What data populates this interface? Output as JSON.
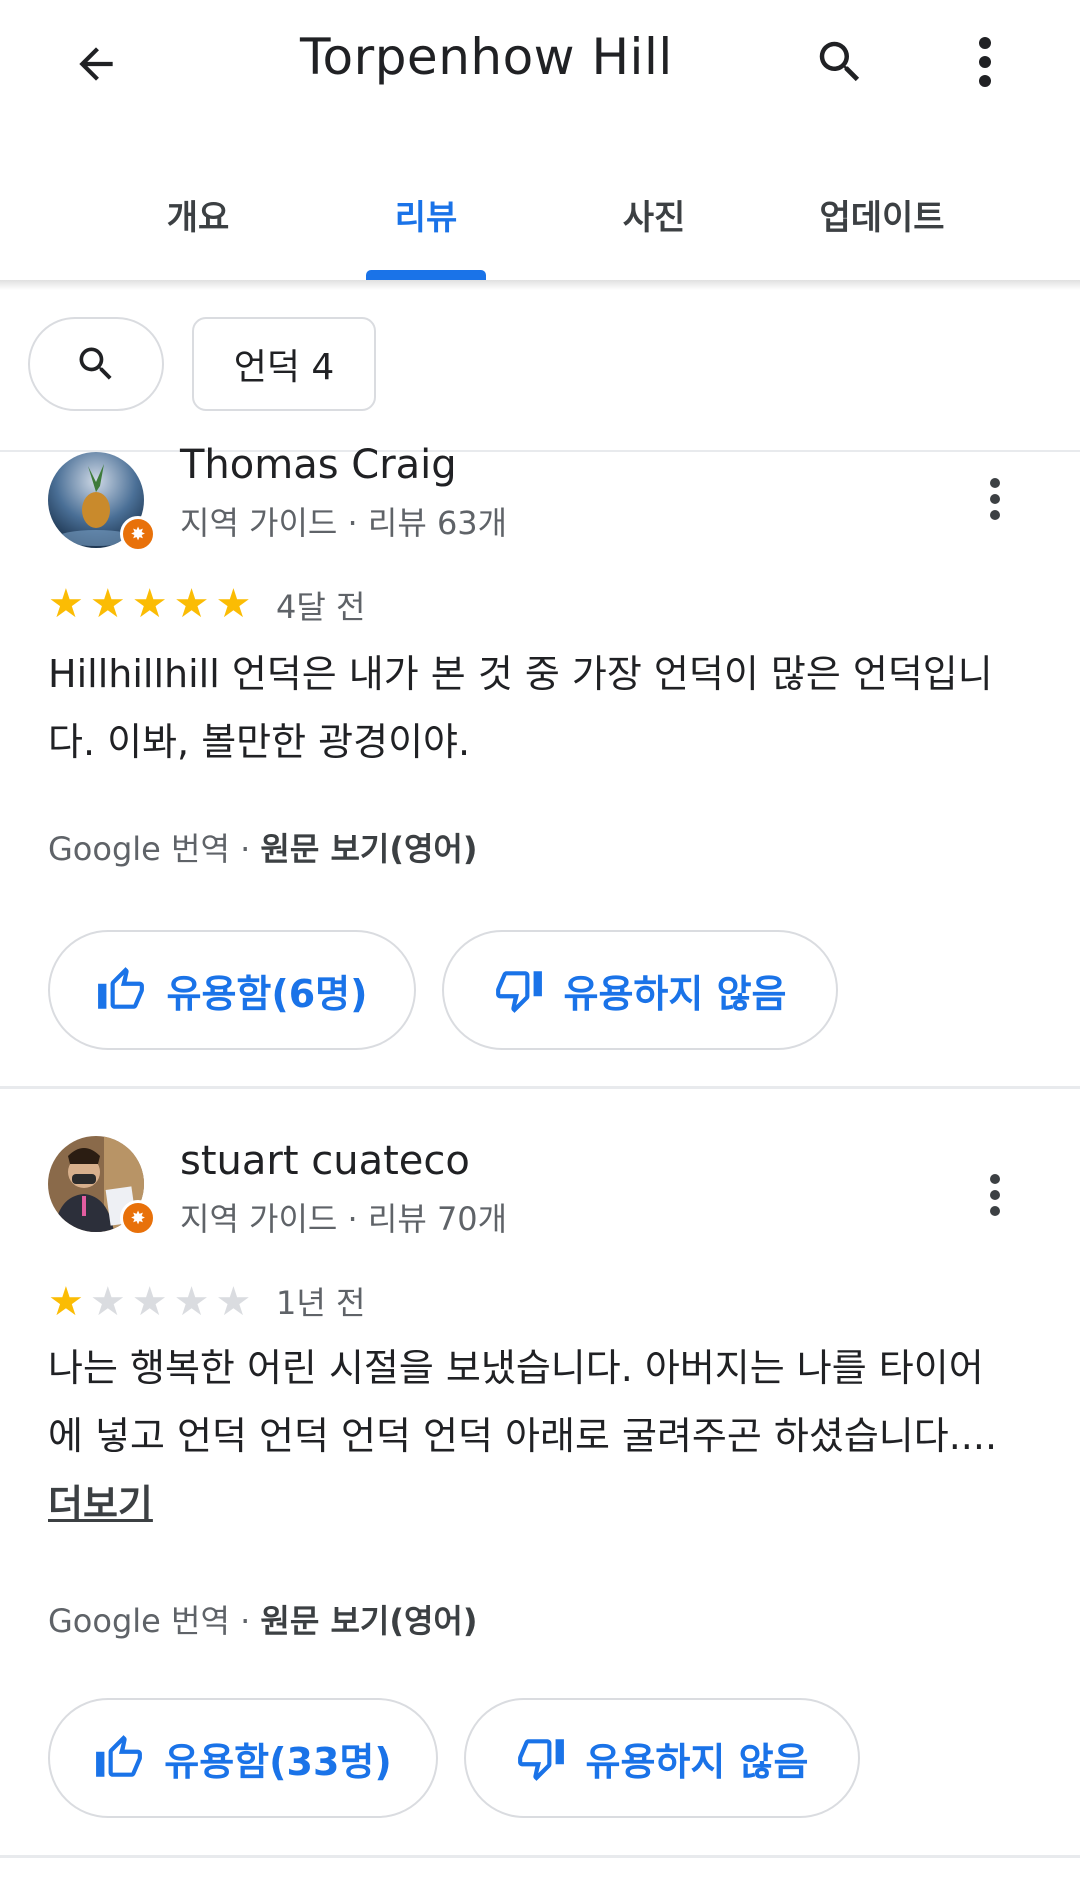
{
  "header": {
    "title": "Torpenhow Hill",
    "back_icon": "arrow-left-icon",
    "search_icon": "search-icon",
    "more_icon": "more-vert-icon"
  },
  "tabs": [
    {
      "label": "개요",
      "active": false
    },
    {
      "label": "리뷰",
      "active": true
    },
    {
      "label": "사진",
      "active": false
    },
    {
      "label": "업데이트",
      "active": false
    }
  ],
  "filters": {
    "search_icon": "search-icon",
    "chip_label": "언덕 4"
  },
  "reviews": [
    {
      "author": "Thomas Craig",
      "meta": "지역 가이드 · 리뷰 63개",
      "rating": 5,
      "date": "4달 전",
      "text": "Hillhillhill 언덕은 내가 본 것 중 가장 언덕이 많은 언덕입니다. 이봐, 볼만한 광경이야.",
      "more_label": "",
      "translate_prefix": "Google 번역 · ",
      "translate_link": "원문 보기(영어)",
      "helpful_label": "유용함(6명)",
      "not_helpful_label": "유용하지 않음"
    },
    {
      "author": "stuart cuateco",
      "meta": "지역 가이드 · 리뷰 70개",
      "rating": 1,
      "date": "1년 전",
      "text": "나는 행복한 어린 시절을 보냈습니다. 아버지는 나를 타이어에 넣고 언덕 언덕 언덕 언덕 아래로 굴려주곤 하셨습니다....",
      "more_label": "더보기",
      "translate_prefix": "Google 번역 · ",
      "translate_link": "원문 보기(영어)",
      "helpful_label": "유용함(33명)",
      "not_helpful_label": "유용하지 않음"
    }
  ],
  "colors": {
    "accent": "#1a73e8",
    "star": "#fbbc04",
    "badge": "#e8710a"
  }
}
